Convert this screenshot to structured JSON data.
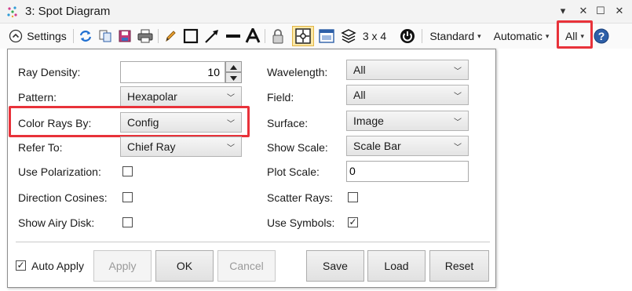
{
  "window": {
    "title": "3: Spot Diagram",
    "controls": {
      "collapse": "▾",
      "close": "✕",
      "maximize": "☐",
      "close2": "✕"
    }
  },
  "toolbar": {
    "settings_label": "Settings",
    "layout_label": "3 x 4",
    "standard_label": "Standard",
    "automatic_label": "Automatic",
    "all_label": "All",
    "caret": "▾",
    "help": "?"
  },
  "settings": {
    "left": {
      "ray_density": {
        "label": "Ray Density:",
        "value": "10"
      },
      "pattern": {
        "label": "Pattern:",
        "value": "Hexapolar"
      },
      "color_rays_by": {
        "label": "Color Rays By:",
        "value": "Config"
      },
      "refer_to": {
        "label": "Refer To:",
        "value": "Chief Ray"
      },
      "use_polarization": {
        "label": "Use Polarization:",
        "checked": false
      },
      "direction_cosines": {
        "label": "Direction Cosines:",
        "checked": false
      },
      "show_airy_disk": {
        "label": "Show Airy Disk:",
        "checked": false
      }
    },
    "right": {
      "wavelength": {
        "label": "Wavelength:",
        "value": "All"
      },
      "field": {
        "label": "Field:",
        "value": "All"
      },
      "surface": {
        "label": "Surface:",
        "value": "Image"
      },
      "show_scale": {
        "label": "Show Scale:",
        "value": "Scale Bar"
      },
      "plot_scale": {
        "label": "Plot Scale:",
        "value": "0"
      },
      "scatter_rays": {
        "label": "Scatter Rays:",
        "checked": false
      },
      "use_symbols": {
        "label": "Use Symbols:",
        "checked": true,
        "mark": "✓"
      }
    },
    "footer": {
      "auto_apply": {
        "label": "Auto Apply",
        "checked": true,
        "mark": "✓"
      },
      "apply": "Apply",
      "ok": "OK",
      "cancel": "Cancel",
      "save": "Save",
      "load": "Load",
      "reset": "Reset"
    }
  },
  "colors": {
    "highlight": "#e8323a",
    "accent": "#1f6fd1"
  }
}
